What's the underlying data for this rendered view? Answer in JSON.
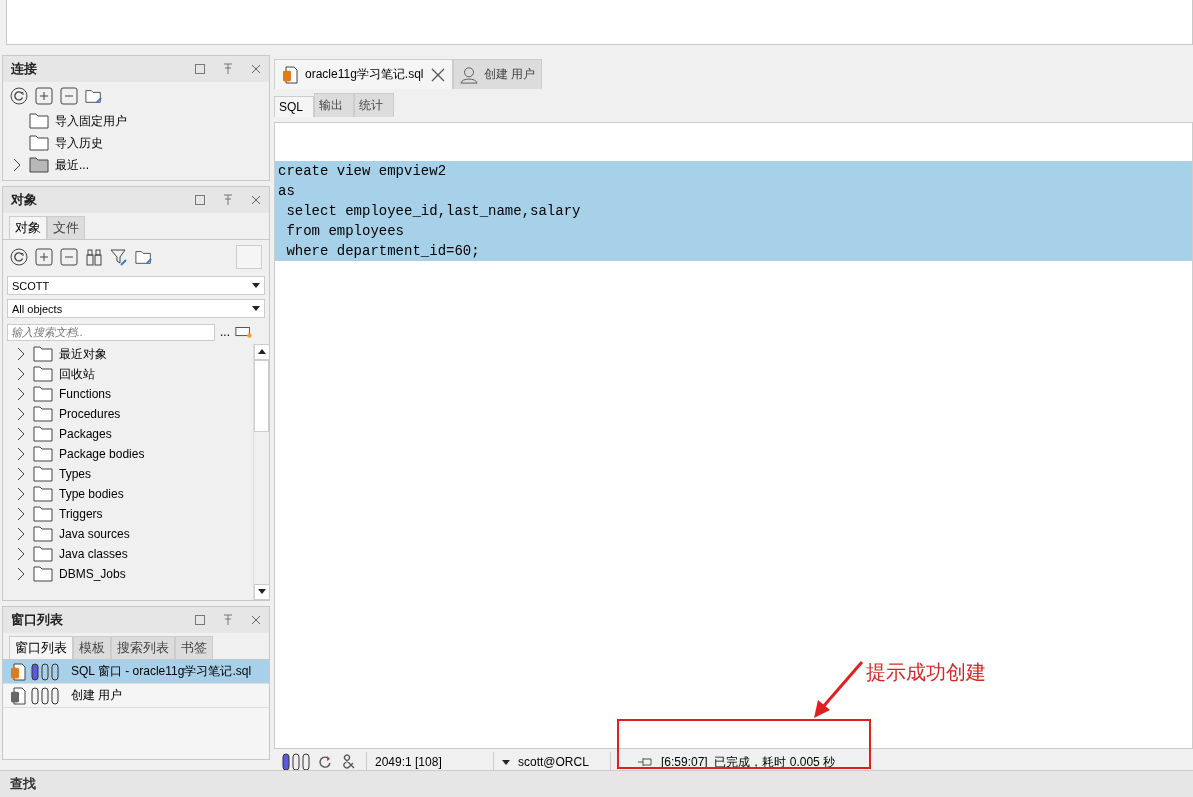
{
  "connections_panel": {
    "title": "连接",
    "items": [
      {
        "label": "导入固定用户",
        "expandable": false
      },
      {
        "label": "导入历史",
        "expandable": false
      },
      {
        "label": "最近...",
        "expandable": true
      }
    ]
  },
  "objects_panel": {
    "title": "对象",
    "tabs": [
      {
        "label": "对象",
        "selected": true
      },
      {
        "label": "文件",
        "selected": false
      }
    ],
    "user_select": "SCOTT",
    "type_select": "All objects",
    "search": {
      "placeholder": "输入搜索文档.."
    },
    "search_more": "...",
    "tree": [
      {
        "label": "最近对象",
        "expanded": false
      },
      {
        "label": "回收站",
        "expanded": false
      },
      {
        "label": "Functions",
        "expanded": false
      },
      {
        "label": "Procedures",
        "expanded": false
      },
      {
        "label": "Packages",
        "expanded": false
      },
      {
        "label": "Package bodies",
        "expanded": false
      },
      {
        "label": "Types",
        "expanded": false
      },
      {
        "label": "Type bodies",
        "expanded": false
      },
      {
        "label": "Triggers",
        "expanded": false
      },
      {
        "label": "Java sources",
        "expanded": false
      },
      {
        "label": "Java classes",
        "expanded": false
      },
      {
        "label": "DBMS_Jobs",
        "expanded": false
      }
    ]
  },
  "window_list_panel": {
    "title": "窗口列表",
    "tabs": [
      {
        "label": "窗口列表",
        "selected": true
      },
      {
        "label": "模板",
        "selected": false
      },
      {
        "label": "搜索列表",
        "selected": false
      },
      {
        "label": "书签",
        "selected": false
      }
    ],
    "items": [
      {
        "label": "SQL 窗口 - oracle11g学习笔记.sql",
        "selected": true,
        "kind": "sql"
      },
      {
        "label": "创建 用户",
        "selected": false,
        "kind": "user"
      }
    ]
  },
  "find_bar": {
    "title": "查找"
  },
  "editor": {
    "doc_tabs": [
      {
        "label": "oracle11g学习笔记.sql",
        "selected": true,
        "kind": "sql"
      },
      {
        "label": "创建 用户",
        "selected": false,
        "kind": "user"
      }
    ],
    "sub_tabs": [
      {
        "label": "SQL",
        "selected": true
      },
      {
        "label": "输出",
        "selected": false
      },
      {
        "label": "统计",
        "selected": false
      }
    ],
    "lines": [
      {
        "text": "create view empview2",
        "selected": true
      },
      {
        "text": "as",
        "selected": true
      },
      {
        "text": " select employee_id,last_name,salary",
        "selected": true
      },
      {
        "text": " from employees",
        "selected": true
      },
      {
        "text": " where department_id=60;",
        "selected": true
      }
    ],
    "status_bar": {
      "position": "2049:1 [108]",
      "connection": "scott@ORCL",
      "message": "[6:59:07]  已完成，耗时 0.005 秒"
    }
  },
  "annotation": {
    "text": "提示成功创建"
  }
}
